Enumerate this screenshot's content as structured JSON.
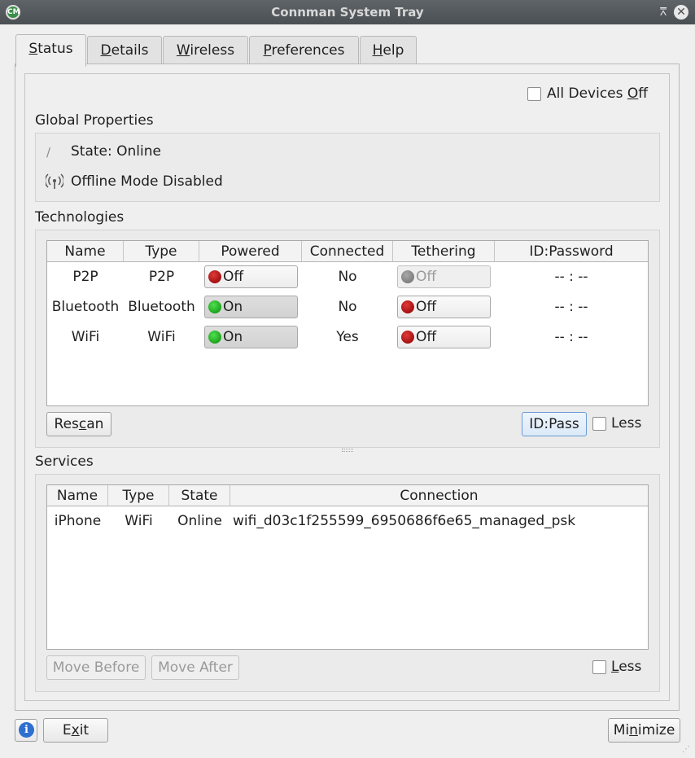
{
  "window": {
    "title": "Connman System Tray",
    "icon_letter": "CM"
  },
  "tabs": [
    {
      "label": "Status",
      "mnemonic": "S",
      "rest": "tatus"
    },
    {
      "label": "Details",
      "mnemonic": "D",
      "rest": "etails"
    },
    {
      "label": "Wireless",
      "mnemonic": "W",
      "rest": "ireless"
    },
    {
      "label": "Preferences",
      "mnemonic": "P",
      "rest": "references"
    },
    {
      "label": "Help",
      "mnemonic": "H",
      "rest": "elp"
    }
  ],
  "all_devices_off": {
    "pre": "All Devices ",
    "mnemonic": "O",
    "post": "ff",
    "checked": false
  },
  "global_properties": {
    "heading": "Global Properties",
    "state": "State: Online",
    "offline_mode": "Offline Mode Disabled"
  },
  "technologies": {
    "heading": "Technologies",
    "columns": [
      "Name",
      "Type",
      "Powered",
      "Connected",
      "Tethering",
      "ID:Password"
    ],
    "rows": [
      {
        "name": "P2P",
        "type": "P2P",
        "powered": "Off",
        "powered_led": "red",
        "connected": "No",
        "tethering": "Off",
        "tether_led": "grey",
        "idpass": "-- : --"
      },
      {
        "name": "Bluetooth",
        "type": "Bluetooth",
        "powered": "On",
        "powered_led": "green",
        "connected": "No",
        "tethering": "Off",
        "tether_led": "red",
        "idpass": "-- : --"
      },
      {
        "name": "WiFi",
        "type": "WiFi",
        "powered": "On",
        "powered_led": "green",
        "connected": "Yes",
        "tethering": "Off",
        "tether_led": "red",
        "idpass": "-- : --"
      }
    ],
    "rescan": {
      "pre": "Res",
      "mnemonic": "c",
      "post": "an"
    },
    "idpass_button": "ID:Pass",
    "less_label": "Less"
  },
  "services": {
    "heading": "Services",
    "columns": [
      "Name",
      "Type",
      "State",
      "Connection"
    ],
    "rows": [
      {
        "name": "iPhone",
        "type": "WiFi",
        "state": "Online",
        "connection": "wifi_d03c1f255599_6950686f6e65_managed_psk"
      }
    ],
    "move_before": "Move Before",
    "move_after": "Move After",
    "less": {
      "mnemonic": "L",
      "rest": "ess"
    }
  },
  "footer": {
    "exit": {
      "pre": "E",
      "mnemonic": "x",
      "post": "it"
    },
    "minimize": {
      "pre": "Mi",
      "mnemonic": "n",
      "post": "imize"
    }
  }
}
